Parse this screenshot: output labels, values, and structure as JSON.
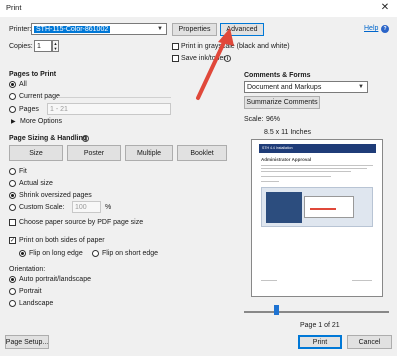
{
  "window": {
    "title": "Print",
    "close_glyph": "✕"
  },
  "printer": {
    "label": "Printer:",
    "selected": "STH-115-Color-861002",
    "properties_label": "Properties",
    "advanced_label": "Advanced",
    "help_label": "Help",
    "help_icon": "?",
    "copies_label": "Copies:",
    "copies_value": "1",
    "print_grayscale_label": "Print in grayscale (black and white)",
    "save_ink_label": "Save ink/toner",
    "save_ink_info": "i"
  },
  "pages_to_print": {
    "header": "Pages to Print",
    "all_label": "All",
    "current_label": "Current page",
    "pages_label": "Pages",
    "pages_value": "1 - 21",
    "more_label": "More Options"
  },
  "sizing": {
    "header": "Page Sizing & Handling",
    "info": "i",
    "tabs": [
      "Size",
      "Poster",
      "Multiple",
      "Booklet"
    ],
    "fit_label": "Fit",
    "actual_label": "Actual size",
    "shrink_label": "Shrink oversized pages",
    "custom_label": "Custom Scale:",
    "custom_value": "100",
    "custom_unit": "%",
    "pdf_source_label": "Choose paper source by PDF page size"
  },
  "duplex": {
    "both_sides_label": "Print on both sides of paper",
    "long_edge_label": "Flip on long edge",
    "short_edge_label": "Flip on short edge"
  },
  "orientation": {
    "header": "Orientation:",
    "auto_label": "Auto portrait/landscape",
    "portrait_label": "Portrait",
    "landscape_label": "Landscape"
  },
  "comments": {
    "header": "Comments & Forms",
    "selected": "Document and Markups",
    "summarize_label": "Summarize Comments"
  },
  "preview": {
    "scale_label": "Scale:",
    "scale_value": "96%",
    "paper_size": "8.5 x 11 Inches",
    "page_banner": "STH 4.4 Installation",
    "page_heading": "Administrator Approval",
    "page_counter": "Page 1 of 21"
  },
  "footer": {
    "page_setup_label": "Page Setup...",
    "print_label": "Print",
    "cancel_label": "Cancel"
  },
  "colors": {
    "accent": "#0078d7",
    "arrow": "#e0483a",
    "banner": "#1f3c78"
  }
}
